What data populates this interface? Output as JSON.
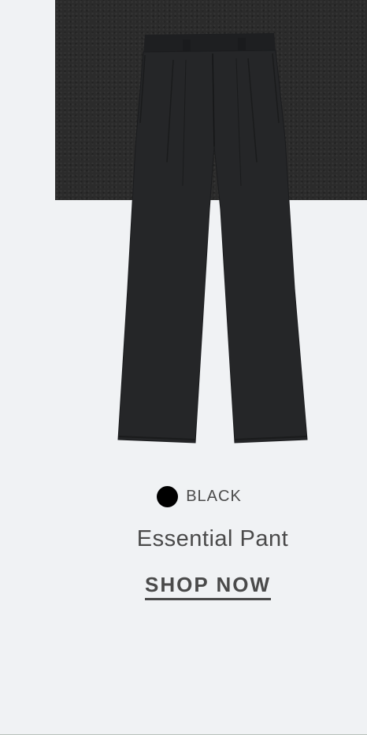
{
  "product": {
    "color_name": "BLACK",
    "color_hex": "#000000",
    "title": "Essential Pant",
    "cta_label": "SHOP NOW"
  },
  "images": {
    "product_image": "black-trousers-image",
    "fabric_image": "fabric-swatch-image"
  },
  "colors": {
    "background": "#f0f2f4",
    "text": "#4a4a4a",
    "fabric": "#2b2b2b"
  }
}
